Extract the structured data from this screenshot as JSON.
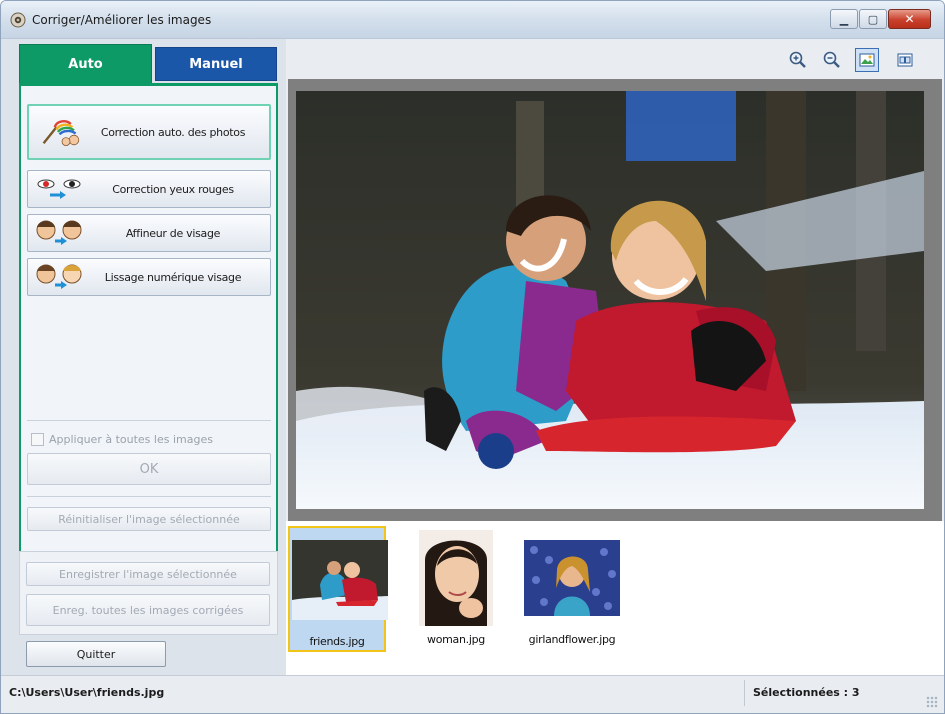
{
  "window": {
    "title": "Corriger/Améliorer les images",
    "icon": "app-camera-icon"
  },
  "tabs": [
    {
      "label": "Auto",
      "active": true,
      "color": "#0d9a67"
    },
    {
      "label": "Manuel",
      "active": false,
      "color": "#1b57a8"
    }
  ],
  "functions": {
    "auto_correct": "Correction auto. des photos",
    "red_eye": "Correction yeux rouges",
    "face_sharpen": "Affineur de visage",
    "face_smooth": "Lissage numérique visage"
  },
  "options": {
    "apply_all": "Appliquer à toutes les images",
    "apply_all_checked": false,
    "ok": "OK",
    "reset": "Réinitialiser l'image sélectionnée"
  },
  "save": {
    "selected": "Enregistrer l'image sélectionnée",
    "all": "Enreg. toutes les images corrigées"
  },
  "quit": "Quitter",
  "toolbar_icons": [
    "zoom-in-icon",
    "zoom-out-icon",
    "fit-view-icon",
    "compare-view-icon"
  ],
  "thumbnails": [
    {
      "name": "friends.jpg",
      "selected": true
    },
    {
      "name": "woman.jpg",
      "selected": false
    },
    {
      "name": "girlandflower.jpg",
      "selected": false
    }
  ],
  "status": {
    "path": "C:\\Users\\User\\friends.jpg",
    "selected": "Sélectionnées : 3"
  },
  "colors": {
    "accent_auto": "#0d9a67",
    "accent_manuel": "#1b57a8",
    "selection": "#f0c419"
  }
}
